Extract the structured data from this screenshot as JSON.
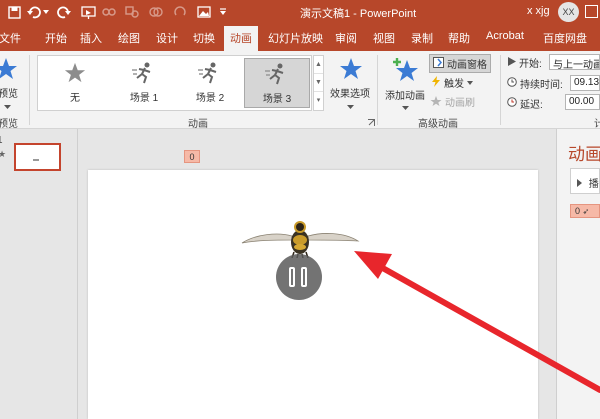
{
  "app": {
    "doc_title": "演示文稿1  -  PowerPoint",
    "user": "x xjg",
    "avatar_initials": "XX",
    "accent_color": "#b7472a",
    "arrow_color": "#e8262c"
  },
  "tabs": [
    {
      "label": "文件"
    },
    {
      "label": "开始"
    },
    {
      "label": "插入"
    },
    {
      "label": "绘图"
    },
    {
      "label": "设计"
    },
    {
      "label": "切换"
    },
    {
      "label": "动画",
      "active": true
    },
    {
      "label": "幻灯片放映"
    },
    {
      "label": "审阅"
    },
    {
      "label": "视图"
    },
    {
      "label": "录制"
    },
    {
      "label": "帮助"
    },
    {
      "label": "Acrobat"
    },
    {
      "label": "百度网盘"
    }
  ],
  "ribbon": {
    "preview": {
      "button": "预览",
      "group": "预览"
    },
    "animations": {
      "group": "动画",
      "items": [
        {
          "label": "无",
          "icon": "star-gray-icon"
        },
        {
          "label": "场景 1",
          "icon": "running-figure-icon"
        },
        {
          "label": "场景 2",
          "icon": "running-figure-icon"
        },
        {
          "label": "场景 3",
          "icon": "running-figure-icon",
          "selected": true
        }
      ],
      "effect_options": "效果选项"
    },
    "advanced": {
      "group": "高级动画",
      "add_animation": "添加动画",
      "animation_pane": "动画窗格",
      "trigger": "触发",
      "painter": "动画刷"
    },
    "timing": {
      "start_label": "开始:",
      "start_value": "与上一动画",
      "duration_label": "持续时间:",
      "duration_value": "09.13",
      "delay_label": "延迟:",
      "delay_value": "00.00",
      "group": "计"
    }
  },
  "slide": {
    "animation_tag": "0",
    "thumbnail_number": "1",
    "pause_icon": "pause-icon"
  },
  "pane": {
    "title": "动画",
    "play_button": "播",
    "item_tag": "0"
  }
}
